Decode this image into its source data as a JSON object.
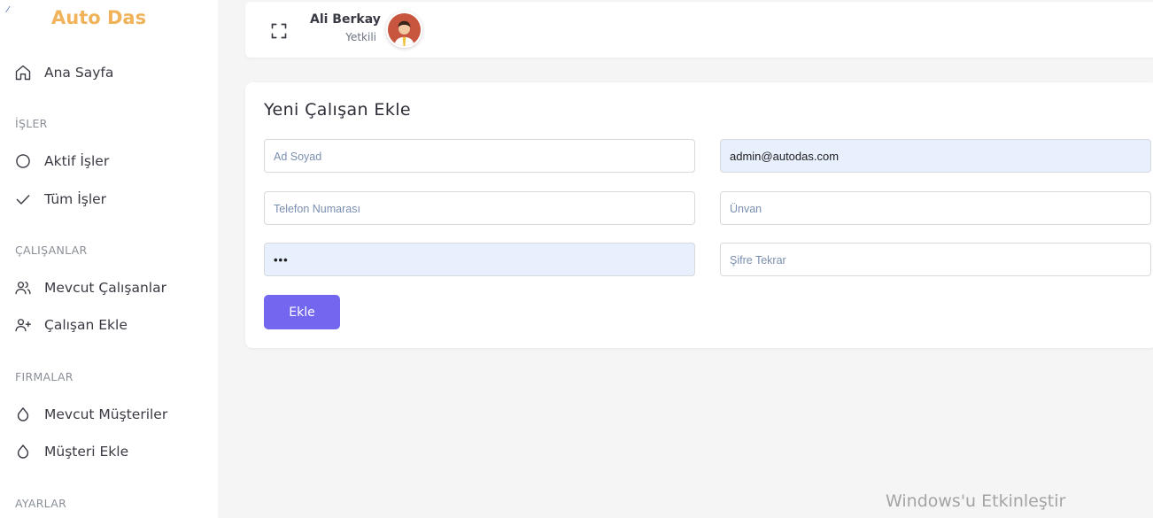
{
  "app": {
    "brand": "Auto Das",
    "logo_mark": "⁄"
  },
  "sidebar": {
    "items": [
      {
        "label": "Ana Sayfa",
        "icon": "home-icon"
      },
      {
        "section": "İŞLER"
      },
      {
        "label": "Aktif İşler",
        "icon": "circle-icon"
      },
      {
        "label": "Tüm İşler",
        "icon": "check-icon"
      },
      {
        "section": "ÇALIŞANLAR"
      },
      {
        "label": "Mevcut Çalışanlar",
        "icon": "users-icon"
      },
      {
        "label": "Çalışan Ekle",
        "icon": "user-plus-icon"
      },
      {
        "section": "FIRMALAR"
      },
      {
        "label": "Mevcut Müşteriler",
        "icon": "droplet-icon"
      },
      {
        "label": "Müşteri Ekle",
        "icon": "droplet-icon"
      },
      {
        "section": "AYARLAR"
      }
    ]
  },
  "header": {
    "user_name": "Ali Berkay",
    "user_role": "Yetkili"
  },
  "form": {
    "title": "Yeni Çalışan Ekle",
    "fields": {
      "name": {
        "placeholder": "Ad Soyad",
        "value": ""
      },
      "email": {
        "placeholder": "",
        "value": "admin@autodas.com"
      },
      "phone": {
        "placeholder": "Telefon Numarası",
        "value": ""
      },
      "title": {
        "placeholder": "Ünvan",
        "value": ""
      },
      "password": {
        "placeholder": "",
        "value": "•••"
      },
      "password_repeat": {
        "placeholder": "Şifre Tekrar",
        "value": ""
      }
    },
    "submit_label": "Ekle"
  },
  "overlay": {
    "watermark": "Windows'u Etkinleştir"
  },
  "colors": {
    "brand": "#f0b35a",
    "accent": "#7367f0",
    "autofill": "#e8f0fe"
  }
}
